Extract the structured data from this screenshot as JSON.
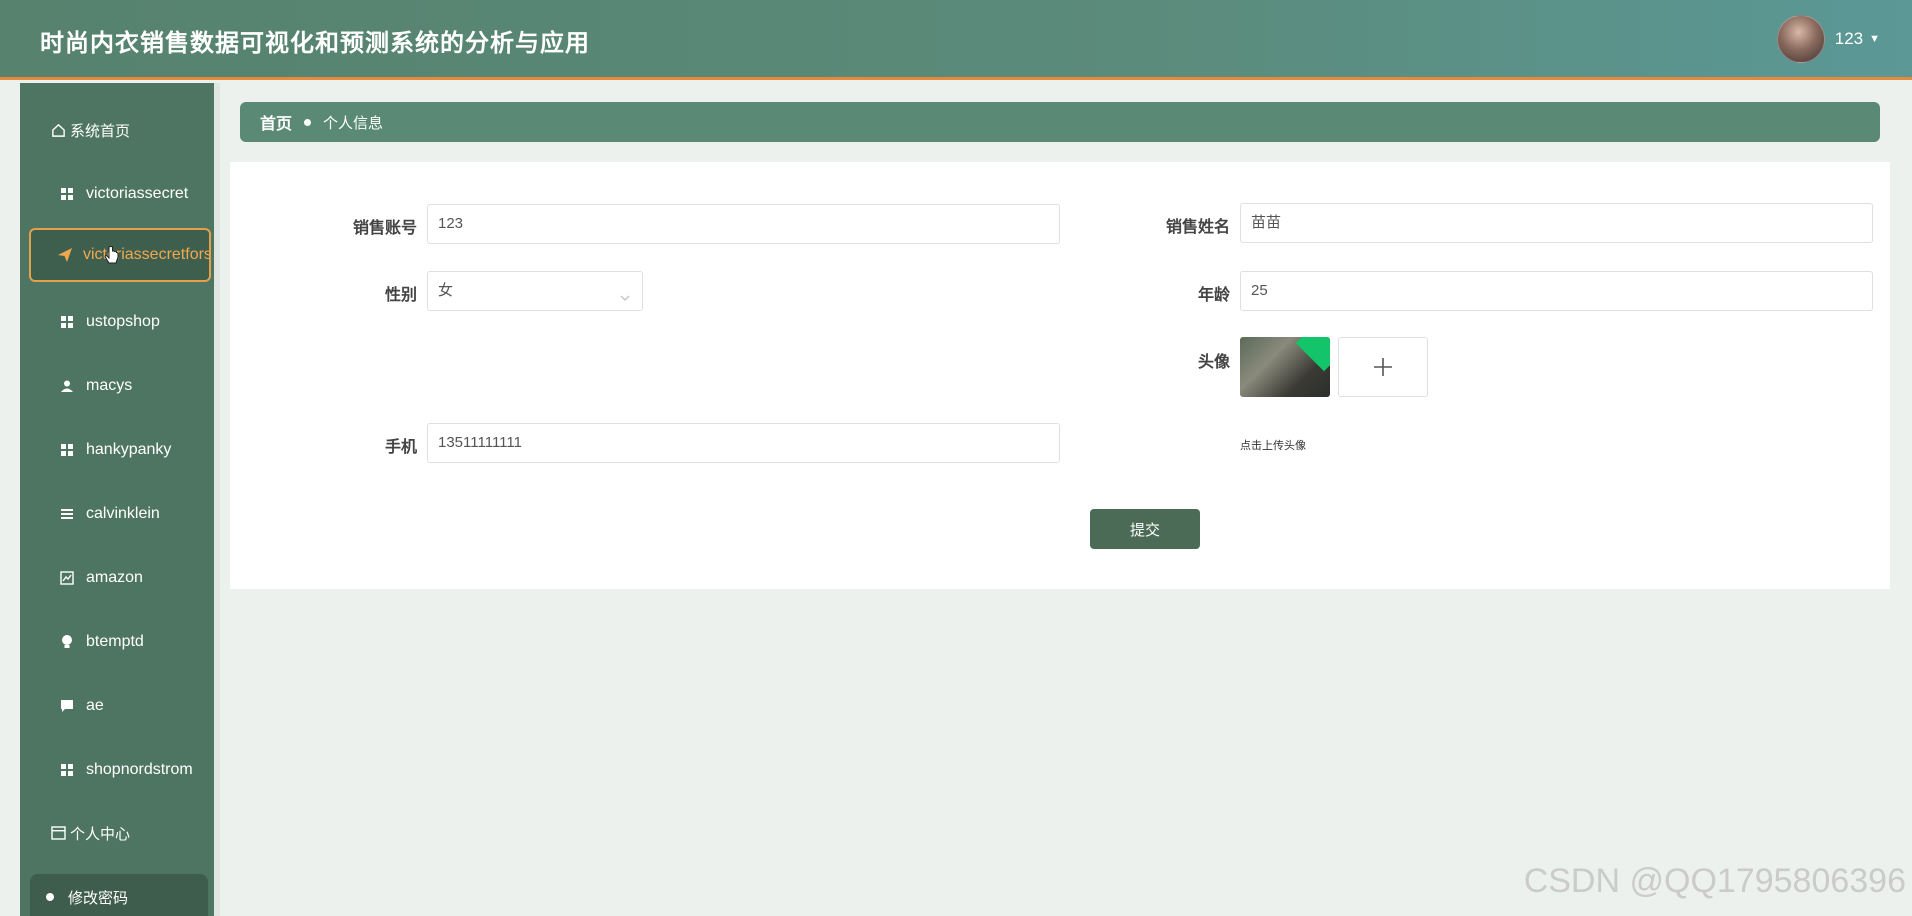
{
  "app": {
    "title": "时尚内衣销售数据可视化和预测系统的分析与应用",
    "user": {
      "name": "123",
      "avatar_icon": "user-avatar"
    }
  },
  "sidebar": {
    "home": {
      "label": "系统首页",
      "icon": "home-icon"
    },
    "items": [
      {
        "label": "victoriassecret",
        "icon": "grid-icon"
      },
      {
        "label": "victoriassecretforsale",
        "icon": "send-icon",
        "active": true
      },
      {
        "label": "ustopshop",
        "icon": "grid-icon"
      },
      {
        "label": "macys",
        "icon": "user-icon"
      },
      {
        "label": "hankypanky",
        "icon": "grid-icon"
      },
      {
        "label": "calvinklein",
        "icon": "list-icon"
      },
      {
        "label": "amazon",
        "icon": "chart-icon"
      },
      {
        "label": "btemptd",
        "icon": "bulb-icon"
      },
      {
        "label": "ae",
        "icon": "comment-icon"
      },
      {
        "label": "shopnordstrom",
        "icon": "grid-icon"
      }
    ],
    "center": {
      "label": "个人中心",
      "icon": "card-icon"
    },
    "change_password": {
      "label": "修改密码"
    }
  },
  "breadcrumb": {
    "home": "首页",
    "current": "个人信息"
  },
  "form": {
    "account": {
      "label": "销售账号",
      "value": "123"
    },
    "name": {
      "label": "销售姓名",
      "value": "苗苗"
    },
    "gender": {
      "label": "性别",
      "value": "女"
    },
    "age": {
      "label": "年龄",
      "value": "25"
    },
    "avatar": {
      "label": "头像",
      "tip": "点击上传头像"
    },
    "phone": {
      "label": "手机",
      "value": "13511111111"
    },
    "submit": "提交"
  },
  "watermark": "CSDN @QQ1795806396",
  "colors": {
    "header": "#5b8b7b",
    "sidebar": "#4e7561",
    "accent": "#e3a14b",
    "button": "#4c6b56"
  }
}
